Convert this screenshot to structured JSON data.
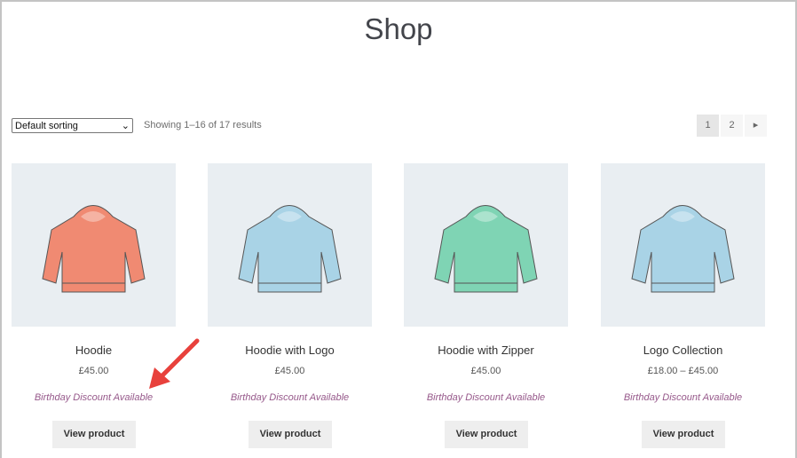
{
  "page_title": "Shop",
  "sorting": {
    "selected": "Default sorting"
  },
  "result_count": "Showing 1–16 of 17 results",
  "pagination": {
    "pages": [
      "1",
      "2"
    ],
    "current": "1",
    "next_icon": "triangle-right-icon"
  },
  "products": [
    {
      "name": "Hoodie",
      "price": "£45.00",
      "discount": "Birthday Discount Available",
      "button": "View product",
      "color": "#f08a72"
    },
    {
      "name": "Hoodie with Logo",
      "price": "£45.00",
      "discount": "Birthday Discount Available",
      "button": "View product",
      "color": "#a9d3e6"
    },
    {
      "name": "Hoodie with Zipper",
      "price": "£45.00",
      "discount": "Birthday Discount Available",
      "button": "View product",
      "color": "#7fd4b4"
    },
    {
      "name": "Logo Collection",
      "price": "£18.00 – £45.00",
      "discount": "Birthday Discount Available",
      "button": "View product",
      "color": "#a9d3e6"
    }
  ],
  "annotation": {
    "arrow_color": "#e8413c"
  }
}
